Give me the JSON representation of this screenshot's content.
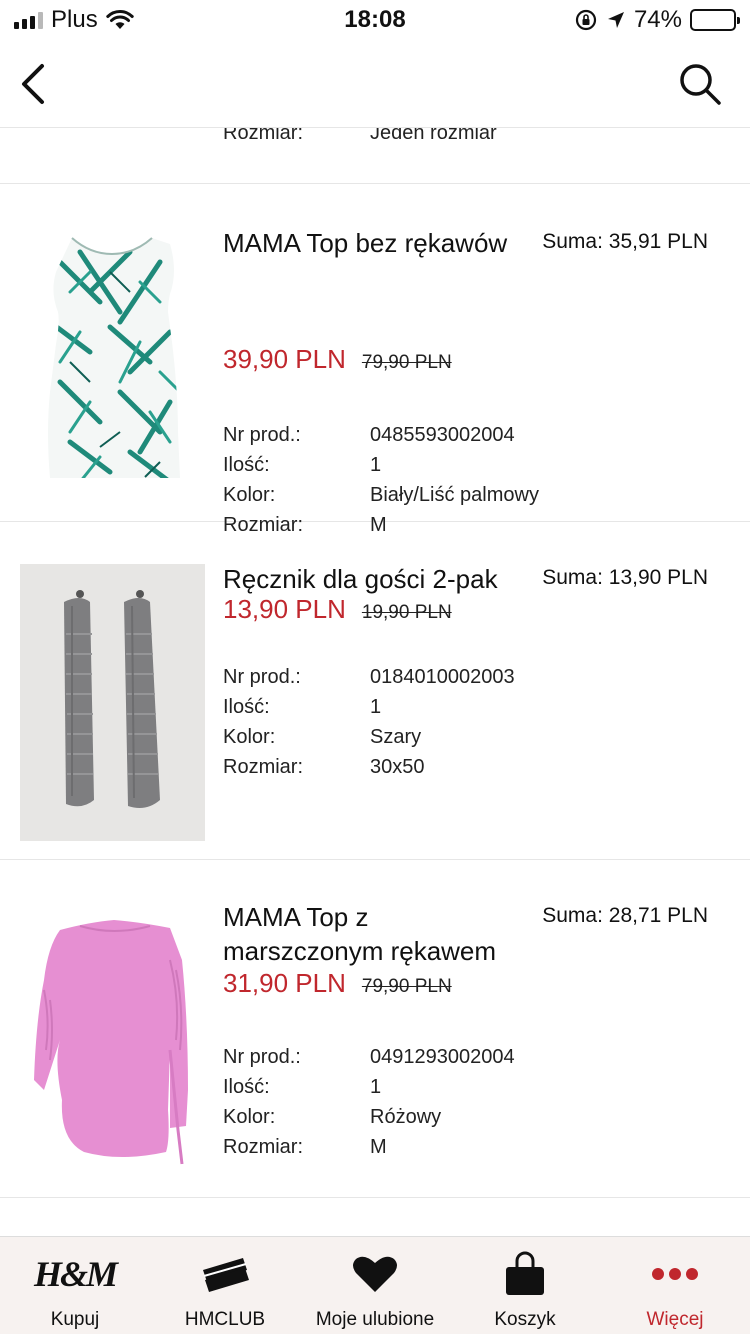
{
  "status_bar": {
    "carrier": "Plus",
    "time": "18:08",
    "battery_pct": "74%",
    "icons": [
      "signal-icon",
      "wifi-icon",
      "rotation-lock-icon",
      "location-arrow-icon",
      "battery-icon"
    ]
  },
  "nav": {
    "back_icon": "chevron-left-icon",
    "search_icon": "search-icon"
  },
  "partial_row": {
    "label": "Rozmiar:",
    "value": "Jeden rozmiar"
  },
  "labels": {
    "nr": "Nr prod.:",
    "qty": "Ilość:",
    "color": "Kolor:",
    "size": "Rozmiar:"
  },
  "items": [
    {
      "name": "MAMA Top bez rękawów",
      "total": "Suma: 35,91 PLN",
      "price": "39,90 PLN",
      "old_price": "79,90 PLN",
      "nr": "0485593002004",
      "qty": "1",
      "color": "Biały/Liść palmowy",
      "size": "M",
      "image": "palm-leaf-dress-image"
    },
    {
      "name": "Ręcznik dla gości 2-pak",
      "total": "Suma: 13,90 PLN",
      "price": "13,90 PLN",
      "old_price": "19,90 PLN",
      "nr": "0184010002003",
      "qty": "1",
      "color": "Szary",
      "size": "30x50",
      "image": "grey-towels-image"
    },
    {
      "name": "MAMA Top z marszczonym rękawem",
      "total": "Suma: 28,71 PLN",
      "price": "31,90 PLN",
      "old_price": "79,90 PLN",
      "nr": "0491293002004",
      "qty": "1",
      "color": "Różowy",
      "size": "M",
      "image": "pink-top-image"
    }
  ],
  "tabs": [
    {
      "label": "Kupuj",
      "icon": "hm-logo-icon"
    },
    {
      "label": "HMCLUB",
      "icon": "club-card-icon"
    },
    {
      "label": "Moje ulubione",
      "icon": "heart-icon"
    },
    {
      "label": "Koszyk",
      "icon": "shopping-bag-icon"
    },
    {
      "label": "Więcej",
      "icon": "more-dots-icon",
      "active": true
    }
  ],
  "colors": {
    "accent_red": "#c0272d",
    "tab_bar_bg": "#f7f2f0",
    "divider": "#e6e6e6"
  }
}
